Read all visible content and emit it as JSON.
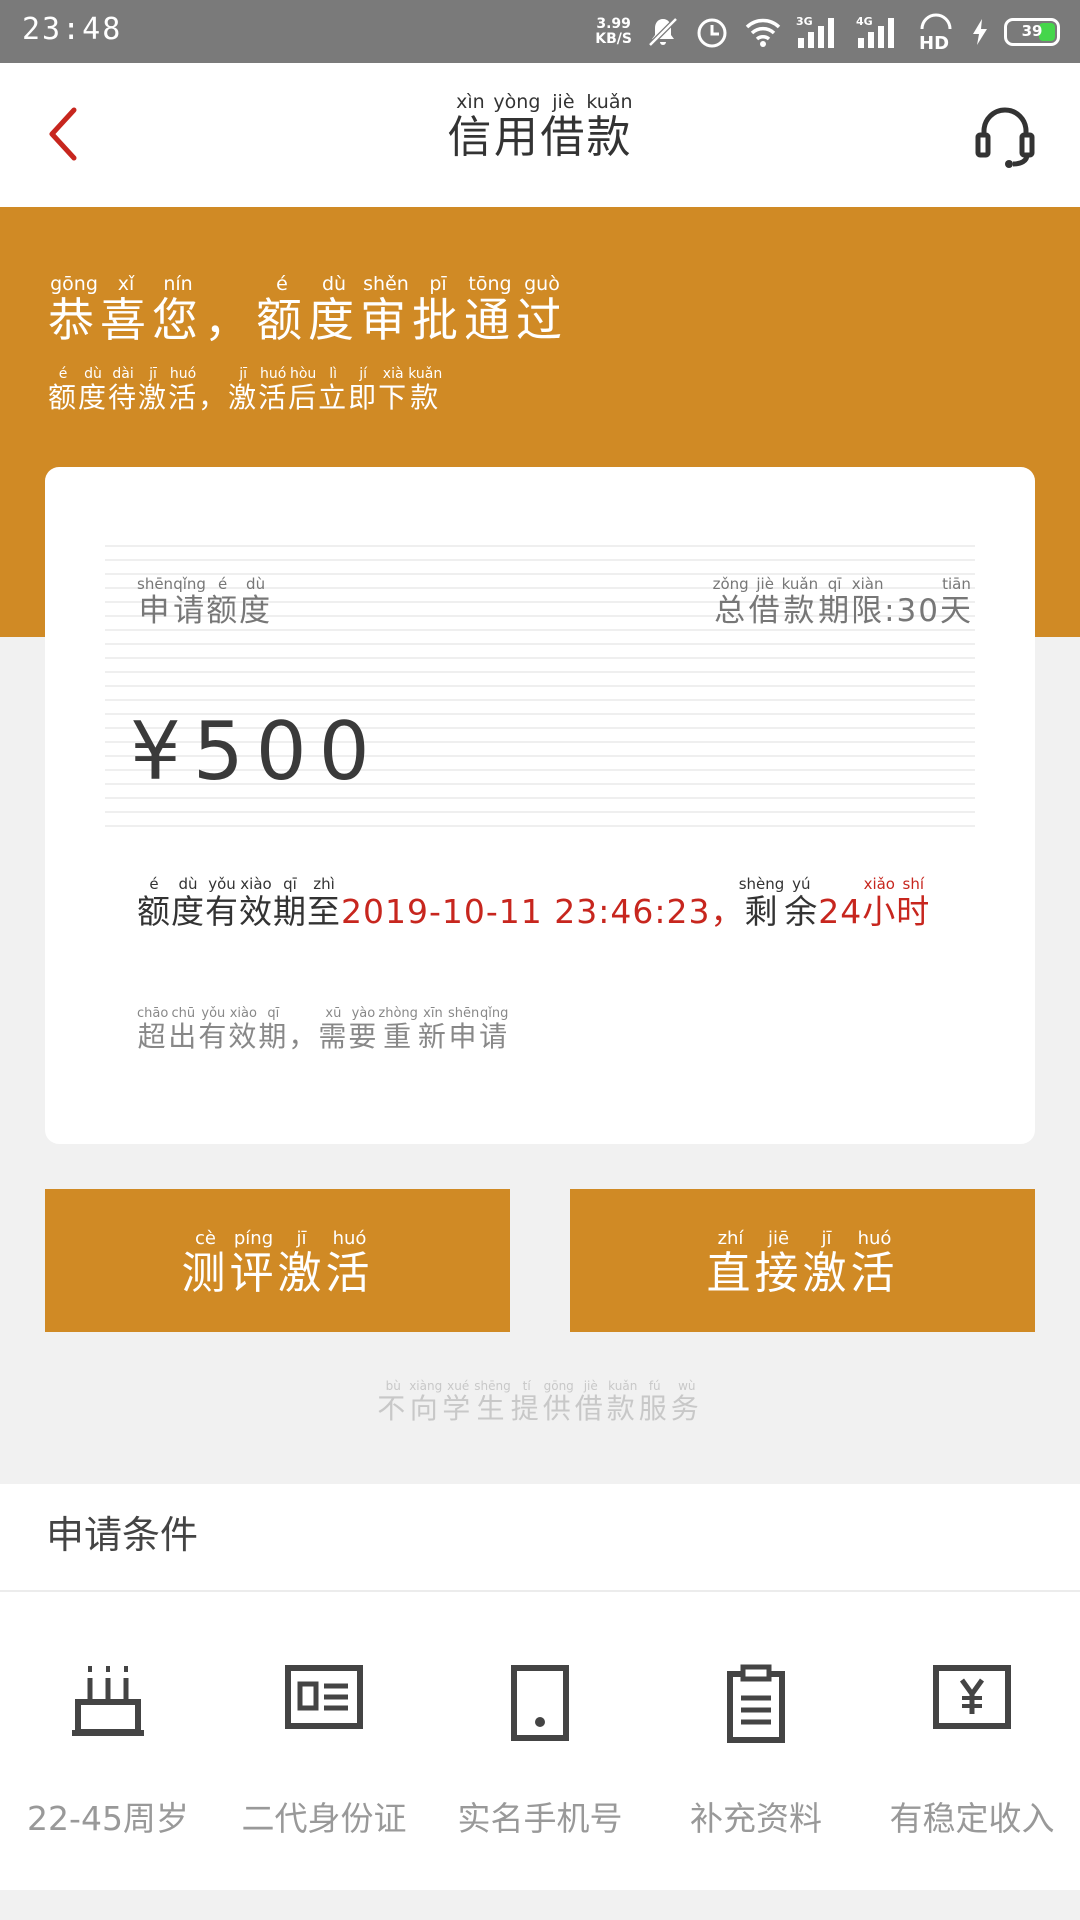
{
  "status_bar": {
    "time": "23:48",
    "net_speed_value": "3.99",
    "net_speed_unit": "KB/S",
    "signal_1": "3G",
    "signal_2": "4G",
    "hd": "HD",
    "battery": "39",
    "battery_color": "#45d64b"
  },
  "nav": {
    "title": [
      {
        "char": "信",
        "pinyin": "xìn"
      },
      {
        "char": "用",
        "pinyin": "yòng"
      },
      {
        "char": "借",
        "pinyin": "jiè"
      },
      {
        "char": "款",
        "pinyin": "kuǎn"
      }
    ],
    "back_icon": "chevron-left-icon",
    "service_icon": "headset-icon"
  },
  "banner": {
    "bg_color": "#d08a25",
    "title": [
      {
        "char": "恭",
        "pinyin": "gōng"
      },
      {
        "char": "喜",
        "pinyin": "xǐ"
      },
      {
        "char": "您",
        "pinyin": "nín"
      },
      {
        "char": "，",
        "pinyin": ""
      },
      {
        "char": "额",
        "pinyin": "é"
      },
      {
        "char": "度",
        "pinyin": "dù"
      },
      {
        "char": "审",
        "pinyin": "shěn"
      },
      {
        "char": "批",
        "pinyin": "pī"
      },
      {
        "char": "通",
        "pinyin": "tōng"
      },
      {
        "char": "过",
        "pinyin": "guò"
      }
    ],
    "subtitle": [
      {
        "char": "额",
        "pinyin": "é"
      },
      {
        "char": "度",
        "pinyin": "dù"
      },
      {
        "char": "待",
        "pinyin": "dài"
      },
      {
        "char": "激",
        "pinyin": "jī"
      },
      {
        "char": "活",
        "pinyin": "huó"
      },
      {
        "char": "，",
        "pinyin": ""
      },
      {
        "char": "激",
        "pinyin": "jī"
      },
      {
        "char": "活",
        "pinyin": "huó"
      },
      {
        "char": "后",
        "pinyin": "hòu"
      },
      {
        "char": "立",
        "pinyin": "lì"
      },
      {
        "char": "即",
        "pinyin": "jí"
      },
      {
        "char": "下",
        "pinyin": "xià"
      },
      {
        "char": "款",
        "pinyin": "kuǎn"
      }
    ]
  },
  "card": {
    "apply_label": [
      {
        "char": "申",
        "pinyin": "shēn"
      },
      {
        "char": "请",
        "pinyin": "qǐng"
      },
      {
        "char": "额",
        "pinyin": "é"
      },
      {
        "char": "度",
        "pinyin": "dù"
      }
    ],
    "term_label": [
      {
        "char": "总",
        "pinyin": "zǒng"
      },
      {
        "char": "借",
        "pinyin": "jiè"
      },
      {
        "char": "款",
        "pinyin": "kuǎn"
      },
      {
        "char": "期",
        "pinyin": "qī"
      },
      {
        "char": "限",
        "pinyin": "xiàn"
      },
      {
        "char": ":30",
        "pinyin": ""
      },
      {
        "char": "天",
        "pinyin": "tiān"
      }
    ],
    "amount": "¥500",
    "validity_prefix": [
      {
        "char": "额",
        "pinyin": "é"
      },
      {
        "char": "度",
        "pinyin": "dù"
      },
      {
        "char": "有",
        "pinyin": "yǒu"
      },
      {
        "char": "效",
        "pinyin": "xiào"
      },
      {
        "char": "期",
        "pinyin": "qī"
      },
      {
        "char": "至",
        "pinyin": "zhì"
      }
    ],
    "validity_datetime": "2019-10-11 23:46:23，",
    "remaining_label": [
      {
        "char": "剩",
        "pinyin": "shèng"
      },
      {
        "char": "余",
        "pinyin": "yú"
      }
    ],
    "remaining_value": "24",
    "remaining_unit": [
      {
        "char": "小",
        "pinyin": "xiǎo"
      },
      {
        "char": "时",
        "pinyin": "shí"
      }
    ],
    "expire_note": [
      {
        "char": "超",
        "pinyin": "chāo"
      },
      {
        "char": "出",
        "pinyin": "chū"
      },
      {
        "char": "有",
        "pinyin": "yǒu"
      },
      {
        "char": "效",
        "pinyin": "xiào"
      },
      {
        "char": "期",
        "pinyin": "qī"
      },
      {
        "char": "，",
        "pinyin": ""
      },
      {
        "char": "需",
        "pinyin": "xū"
      },
      {
        "char": "要",
        "pinyin": "yào"
      },
      {
        "char": "重",
        "pinyin": "zhòng"
      },
      {
        "char": "新",
        "pinyin": "xīn"
      },
      {
        "char": "申",
        "pinyin": "shēn"
      },
      {
        "char": "请",
        "pinyin": "qǐng"
      }
    ],
    "highlight_color": "#c7261e"
  },
  "buttons": {
    "eval_activate": [
      {
        "char": "测",
        "pinyin": "cè"
      },
      {
        "char": "评",
        "pinyin": "píng"
      },
      {
        "char": "激",
        "pinyin": "jī"
      },
      {
        "char": "活",
        "pinyin": "huó"
      }
    ],
    "direct_activate": [
      {
        "char": "直",
        "pinyin": "zhí"
      },
      {
        "char": "接",
        "pinyin": "jiē"
      },
      {
        "char": "激",
        "pinyin": "jī"
      },
      {
        "char": "活",
        "pinyin": "huó"
      }
    ]
  },
  "notice": [
    {
      "char": "不",
      "pinyin": "bù"
    },
    {
      "char": "向",
      "pinyin": "xiàng"
    },
    {
      "char": "学",
      "pinyin": "xué"
    },
    {
      "char": "生",
      "pinyin": "shēng"
    },
    {
      "char": "提",
      "pinyin": "tí"
    },
    {
      "char": "供",
      "pinyin": "gōng"
    },
    {
      "char": "借",
      "pinyin": "jiè"
    },
    {
      "char": "款",
      "pinyin": "kuǎn"
    },
    {
      "char": "服",
      "pinyin": "fú"
    },
    {
      "char": "务",
      "pinyin": "wù"
    }
  ],
  "conditions": {
    "header": "申请条件",
    "items": [
      {
        "label": "22-45周岁",
        "icon": "birthday-cake-icon"
      },
      {
        "label": "二代身份证",
        "icon": "id-card-icon"
      },
      {
        "label": "实名手机号",
        "icon": "mobile-phone-icon"
      },
      {
        "label": "补充资料",
        "icon": "clipboard-icon"
      },
      {
        "label": "有稳定收入",
        "icon": "income-icon"
      }
    ]
  }
}
